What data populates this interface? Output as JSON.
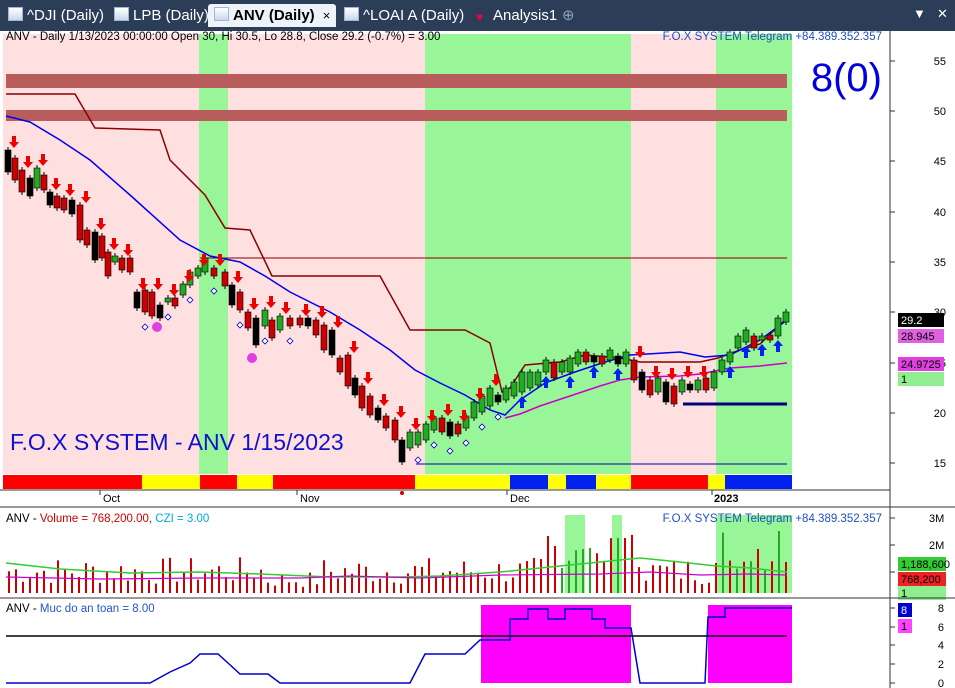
{
  "tabs": [
    {
      "label": "^DJI (Daily)",
      "active": false
    },
    {
      "label": "LPB (Daily)",
      "active": false
    },
    {
      "label": "ANV (Daily)",
      "active": true
    },
    {
      "label": "^LOAI A (Daily)",
      "active": false
    },
    {
      "label": "Analysis1",
      "active": false
    }
  ],
  "tab_close": "×",
  "tab_add": "⊕",
  "window_controls": {
    "minimize": "▼",
    "close": "✕"
  },
  "price_panel": {
    "header": "ANV - Daily 1/13/2023 00:00:00 Open 30, Hi 30.5, Lo 28.8, Close 29.2 (-0.7%)   = 3.00",
    "telegram": "F.O.X SYSTEM Telegram +84.389.352.357",
    "big_count": "8(0)",
    "watermark": "F.O.X SYSTEM - ANV 1/15/2023",
    "y_ticks": [
      "55",
      "50",
      "45",
      "40",
      "35",
      "30",
      "25",
      "20",
      "15"
    ],
    "x_labels": [
      "Oct",
      "Nov",
      "Dec",
      "2023"
    ],
    "badges": [
      {
        "text": "29.2",
        "bg": "#000000",
        "fg": "#ffffff"
      },
      {
        "text": "28.945",
        "bg": "#e060e0",
        "fg": "#000000"
      },
      {
        "text": "24.9725",
        "bg": "#e040e0",
        "fg": "#000000"
      },
      {
        "text": "1",
        "bg": "#90ee90",
        "fg": "#000000"
      }
    ]
  },
  "volume_panel": {
    "header_symbol": "ANV - ",
    "header_volume": "Volume = 768,200.00, ",
    "header_czi": "CZI = 3.00",
    "telegram": "F.O.X SYSTEM Telegram +84.389.352.357",
    "y_ticks": [
      "3M",
      "2M",
      "1M"
    ],
    "badges": [
      {
        "text": "1,188,600",
        "bg": "#33cc33",
        "fg": "#000000"
      },
      {
        "text": "768,200",
        "bg": "#ee2222",
        "fg": "#000000"
      },
      {
        "text": "1",
        "bg": "#90ee90",
        "fg": "#000000"
      }
    ]
  },
  "safety_panel": {
    "header_symbol": "ANV - ",
    "header_label": "Muc do an toan = 8.00",
    "y_ticks": [
      "8",
      "6",
      "4",
      "2",
      "0"
    ],
    "badges": [
      {
        "text": "8",
        "bg": "#0000cc",
        "fg": "#ffffff"
      },
      {
        "text": "1",
        "bg": "#ff44ff",
        "fg": "#000000"
      }
    ]
  },
  "colors": {
    "tab_bar": "#2c3e57",
    "bear_zone": "#ffe0e0",
    "bull_zone": "#98f598",
    "resistance_band": "#b85c5c",
    "big_count": "#0000dd",
    "watermark": "#1111cc",
    "telegram": "#1f4fc0",
    "blue_line": "#0000ee",
    "dark_red_line": "#8b0000",
    "magenta_line": "#cc00cc",
    "bull_candle": "#22aa22",
    "bear_candle": "#cc0000",
    "safety_fill": "#ff00ff"
  }
}
